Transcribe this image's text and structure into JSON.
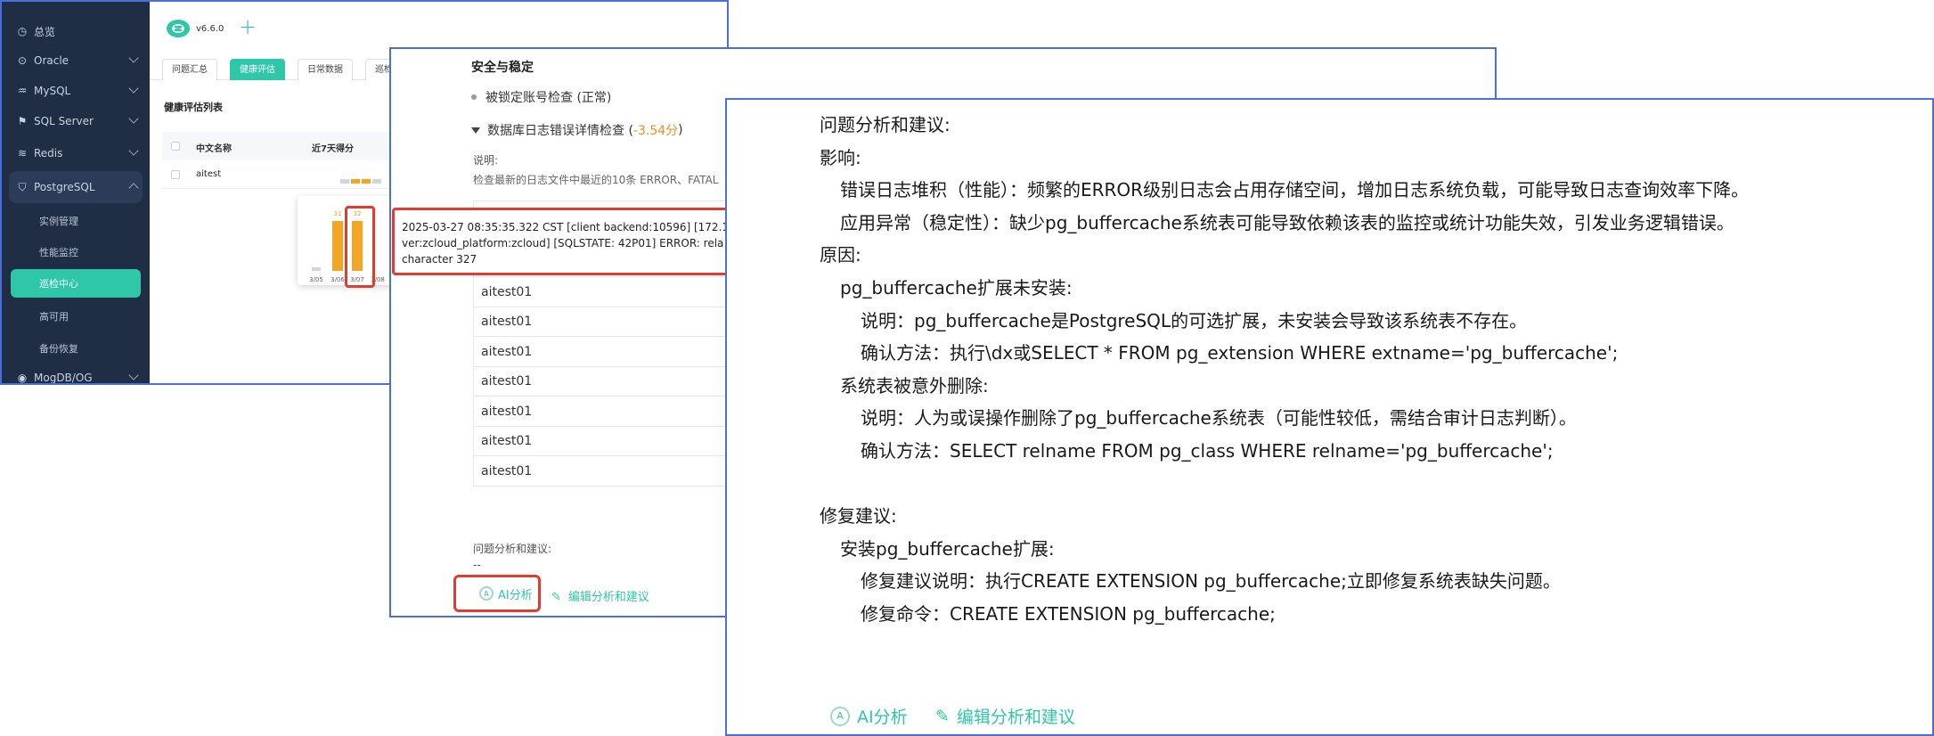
{
  "app": {
    "version": "v6.6.0",
    "sidebar": {
      "items": [
        {
          "label": "总览",
          "icon": "dashboard-icon"
        },
        {
          "label": "Oracle",
          "icon": "oracle-icon"
        },
        {
          "label": "MySQL",
          "icon": "mysql-icon"
        },
        {
          "label": "SQL Server",
          "icon": "sqlserver-icon"
        },
        {
          "label": "Redis",
          "icon": "redis-icon"
        },
        {
          "label": "PostgreSQL",
          "icon": "postgresql-icon"
        },
        {
          "label": "MogDB/OG",
          "icon": "mogdb-icon"
        }
      ],
      "sub_items": [
        "实例管理",
        "性能监控",
        "巡检中心",
        "高可用",
        "备份恢复"
      ],
      "active_sub": "巡检中心"
    },
    "tabs": [
      "问题汇总",
      "健康评估",
      "日常数据",
      "巡检设"
    ],
    "active_tab": "健康评估",
    "list_title": "健康评估列表",
    "table": {
      "headers": [
        "中文名称",
        "近7天得分"
      ],
      "rows": [
        {
          "name": "aitest"
        }
      ]
    },
    "popup_chart": {
      "dates": [
        "3/05",
        "3/06",
        "3/07",
        "3/08"
      ],
      "labels": [
        "31",
        "32"
      ]
    }
  },
  "detail": {
    "section_title": "安全与稳定",
    "checks": [
      {
        "label": "被锁定账号检查 (正常)"
      },
      {
        "label_prefix": "数据库日志错误详情检查 (",
        "score": "-3.54分",
        "label_suffix": ")"
      }
    ],
    "desc_label": "说明:",
    "desc_text": "检查最新的日志文件中最近的10条 ERROR、FATAL",
    "log_rows": [
      "aitest01",
      "aitest01",
      "aitest01",
      "aitest01",
      "aitest01",
      "aitest01",
      "aitest01",
      "aitest01"
    ],
    "log_popup": [
      "2025-03-27 08:35:35.322 CST [client backend:10596] [172.1",
      "ver:zcloud_platform:zcloud] [SQLSTATE: 42P01] ERROR: rela",
      "character 327"
    ],
    "analysis_label": "问题分析和建议:",
    "analysis_value": "--",
    "ai_button": "AI分析",
    "edit_button": "编辑分析和建议"
  },
  "analysis": {
    "lines": [
      {
        "text": "问题分析和建议:",
        "indent": 0
      },
      {
        "text": "影响:",
        "indent": 0
      },
      {
        "text": "错误日志堆积（性能）：频繁的ERROR级别日志会占用存储空间，增加日志系统负载，可能导致日志查询效率下降。",
        "indent": 1
      },
      {
        "text": "应用异常（稳定性）：缺少pg_buffercache系统表可能导致依赖该表的监控或统计功能失效，引发业务逻辑错误。",
        "indent": 1
      },
      {
        "text": "原因:",
        "indent": 0
      },
      {
        "text": "pg_buffercache扩展未安装:",
        "indent": 1
      },
      {
        "text": "说明：pg_buffercache是PostgreSQL的可选扩展，未安装会导致该系统表不存在。",
        "indent": 2
      },
      {
        "text": "确认方法：执行\\dx或SELECT * FROM pg_extension WHERE extname='pg_buffercache';",
        "indent": 2
      },
      {
        "text": "系统表被意外删除:",
        "indent": 1
      },
      {
        "text": "说明：人为或误操作删除了pg_buffercache系统表（可能性较低，需结合审计日志判断）。",
        "indent": 2
      },
      {
        "text": "确认方法：SELECT relname FROM pg_class WHERE relname='pg_buffercache';",
        "indent": 2
      },
      {
        "text": "",
        "indent": 0
      },
      {
        "text": "修复建议:",
        "indent": 0
      },
      {
        "text": "安装pg_buffercache扩展:",
        "indent": 1
      },
      {
        "text": "修复建议说明：执行CREATE EXTENSION pg_buffercache;立即修复系统表缺失问题。",
        "indent": 2
      },
      {
        "text": "修复命令：CREATE EXTENSION pg_buffercache;",
        "indent": 2
      }
    ],
    "ai_button": "AI分析",
    "edit_button": "编辑分析和建议"
  },
  "colors": {
    "accent": "#2ec7a8",
    "highlight": "#e03c31",
    "warning": "#f08c1f",
    "frame": "#4a6fd8"
  }
}
